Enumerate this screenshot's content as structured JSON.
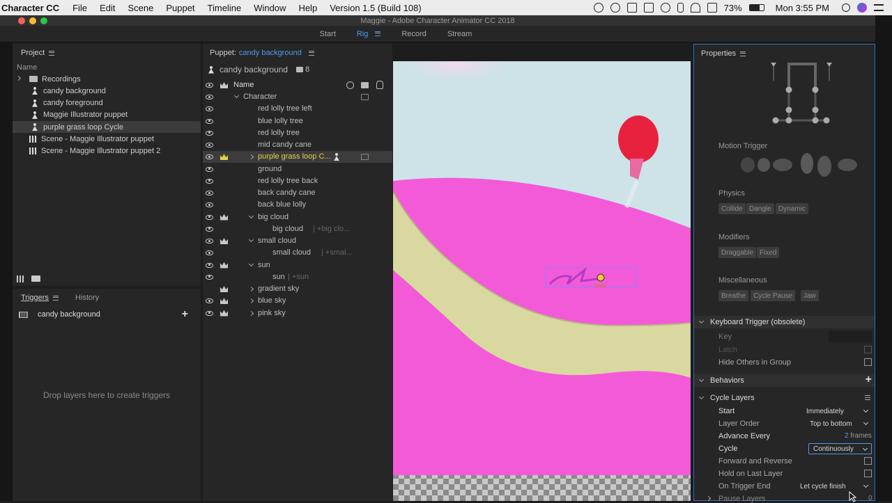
{
  "menubar": {
    "app_name": "Character CC",
    "items": [
      "File",
      "Edit",
      "Scene",
      "Puppet",
      "Timeline",
      "Window",
      "Help",
      "Version 1.5 (Build 108)"
    ],
    "battery": "73%",
    "clock": "Mon 3:55 PM"
  },
  "window": {
    "title": "Maggie - Adobe Character Animator CC 2018"
  },
  "modes": {
    "start": "Start",
    "rig": "Rig",
    "record": "Record",
    "stream": "Stream"
  },
  "project": {
    "title": "Project",
    "column": "Name",
    "items": [
      {
        "label": "Recordings",
        "kind": "folder"
      },
      {
        "label": "candy background",
        "kind": "puppet"
      },
      {
        "label": "candy foreground",
        "kind": "puppet"
      },
      {
        "label": "Maggie Illustrator puppet",
        "kind": "puppet"
      },
      {
        "label": "purple grass loop Cycle",
        "kind": "puppet"
      },
      {
        "label": "Scene - Maggie Illustrator puppet",
        "kind": "scene"
      },
      {
        "label": "Scene - Maggie Illustrator puppet 2",
        "kind": "scene"
      }
    ]
  },
  "triggers": {
    "tab_triggers": "Triggers",
    "tab_history": "History",
    "puppet": "candy background",
    "drop_hint": "Drop layers here to create triggers"
  },
  "puppet_panel": {
    "title_prefix": "Puppet:",
    "title_name": "candy background",
    "root": "candy background",
    "root_count": "8",
    "column_name": "Name",
    "layers": [
      {
        "label": "Character",
        "indent": 1,
        "eye": true,
        "crown": false,
        "arrow": "down"
      },
      {
        "label": "red lolly tree left",
        "indent": 2,
        "eye": true,
        "crown": false,
        "arrow": ""
      },
      {
        "label": "blue lolly tree",
        "indent": 2,
        "eye": true,
        "crown": false,
        "arrow": ""
      },
      {
        "label": "red lolly tree",
        "indent": 2,
        "eye": true,
        "crown": false,
        "arrow": ""
      },
      {
        "label": "mid candy cane",
        "indent": 2,
        "eye": true,
        "crown": false,
        "arrow": ""
      },
      {
        "label": "purple grass loop C...",
        "indent": 2,
        "eye": true,
        "crown": true,
        "arrow": "right",
        "selected": true
      },
      {
        "label": "ground",
        "indent": 2,
        "eye": true,
        "crown": false,
        "arrow": ""
      },
      {
        "label": "red lolly tree back",
        "indent": 2,
        "eye": true,
        "crown": false,
        "arrow": ""
      },
      {
        "label": "back candy cane",
        "indent": 2,
        "eye": true,
        "crown": false,
        "arrow": ""
      },
      {
        "label": "back blue lolly",
        "indent": 2,
        "eye": true,
        "crown": false,
        "arrow": ""
      },
      {
        "label": "big cloud",
        "indent": 2,
        "eye": true,
        "crown": true,
        "arrow": "down"
      },
      {
        "label": "big cloud",
        "indent": 3,
        "eye": true,
        "crown": false,
        "arrow": "",
        "suffix": "| +big clo..."
      },
      {
        "label": "small cloud",
        "indent": 2,
        "eye": true,
        "crown": true,
        "arrow": "down"
      },
      {
        "label": "small cloud",
        "indent": 3,
        "eye": true,
        "crown": false,
        "arrow": "",
        "suffix": "| +smal..."
      },
      {
        "label": "sun",
        "indent": 2,
        "eye": true,
        "crown": true,
        "arrow": "down"
      },
      {
        "label": "sun",
        "indent": 3,
        "eye": true,
        "crown": false,
        "arrow": "",
        "suffix": "| +sun"
      },
      {
        "label": "gradient sky",
        "indent": 2,
        "eye": false,
        "crown": true,
        "arrow": "right"
      },
      {
        "label": "blue sky",
        "indent": 2,
        "eye": true,
        "crown": true,
        "arrow": "right"
      },
      {
        "label": "pink sky",
        "indent": 2,
        "eye": true,
        "crown": true,
        "arrow": "right"
      }
    ]
  },
  "stage": {
    "origin_label": "origin",
    "colors": {
      "sky": "#cde3e8",
      "ground": "#f35ad8",
      "path": "#d8d8a0",
      "balloon": "#e8223e"
    }
  },
  "properties": {
    "title": "Properties",
    "motion_trigger": "Motion Trigger",
    "physics": {
      "label": "Physics",
      "chips": [
        "Collide",
        "Dangle",
        "Dynamic"
      ]
    },
    "modifiers": {
      "label": "Modifiers",
      "chips": [
        "Draggable",
        "Fixed"
      ]
    },
    "misc": {
      "label": "Miscellaneous",
      "chips": [
        "Breathe",
        "Cycle Pause",
        "Jaw"
      ]
    },
    "keyboard_trigger": {
      "header": "Keyboard Trigger (obsolete)",
      "key": "Key",
      "latch": "Latch",
      "hide_others": "Hide Others in Group"
    },
    "behaviors": "Behaviors",
    "cycle_layers": {
      "header": "Cycle Layers",
      "rows": {
        "start": {
          "label": "Start",
          "value": "Immediately"
        },
        "layer_order": {
          "label": "Layer Order",
          "value": "Top to bottom"
        },
        "advance_every": {
          "label": "Advance Every",
          "value": "2",
          "unit": "frames"
        },
        "cycle": {
          "label": "Cycle",
          "value": "Continuously"
        },
        "forward_reverse": {
          "label": "Forward and Reverse"
        },
        "hold_last": {
          "label": "Hold on Last Layer"
        },
        "on_trigger_end": {
          "label": "On Trigger End",
          "value": "Let cycle finish"
        },
        "pause_layers": {
          "label": "Pause Layers",
          "value": "0"
        }
      }
    }
  }
}
